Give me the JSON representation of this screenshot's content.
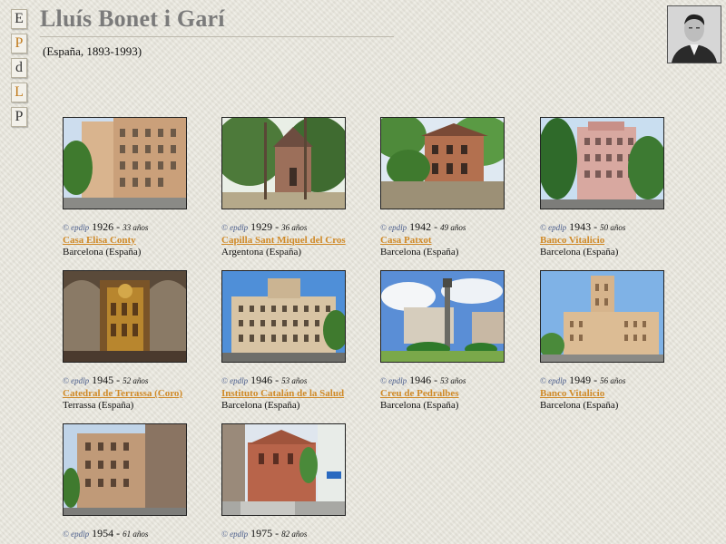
{
  "nav": {
    "letters": [
      "E",
      "P",
      "d",
      "L",
      "P"
    ]
  },
  "header": {
    "title": "Lluís Bonet i Garí",
    "subtitle": "(España, 1893-1993)"
  },
  "works": [
    {
      "copy": "© epdlp",
      "year": "1926",
      "sep": "-",
      "age": "33 años",
      "name": "Casa Elisa Conty",
      "location": "Barcelona (España)"
    },
    {
      "copy": "© epdlp",
      "year": "1929",
      "sep": "-",
      "age": "36 años",
      "name": "Capilla Sant Miquel del Cros",
      "location": "Argentona (España)"
    },
    {
      "copy": "© epdlp",
      "year": "1942",
      "sep": "-",
      "age": "49 años",
      "name": "Casa Patxot",
      "location": "Barcelona (España)"
    },
    {
      "copy": "© epdlp",
      "year": "1943",
      "sep": "-",
      "age": "50 años",
      "name": "Banco Vitalicio",
      "location": "Barcelona (España)"
    },
    {
      "copy": "© epdlp",
      "year": "1945",
      "sep": "-",
      "age": "52 años",
      "name": "Catedral de Terrassa (Coro)",
      "location": "Terrassa (España)"
    },
    {
      "copy": "© epdlp",
      "year": "1946",
      "sep": "-",
      "age": "53 años",
      "name": "Instituto Catalán de la Salud",
      "location": "Barcelona (España)"
    },
    {
      "copy": "© epdlp",
      "year": "1946",
      "sep": "-",
      "age": "53 años",
      "name": "Creu de Pedralbes",
      "location": "Barcelona (España)"
    },
    {
      "copy": "© epdlp",
      "year": "1949",
      "sep": "-",
      "age": "56 años",
      "name": "Banco Vitalicio",
      "location": "Barcelona (España)"
    },
    {
      "copy": "© epdlp",
      "year": "1954",
      "sep": "-",
      "age": "61 años",
      "name": "",
      "location": ""
    },
    {
      "copy": "© epdlp",
      "year": "1975",
      "sep": "-",
      "age": "82 años",
      "name": "",
      "location": ""
    }
  ],
  "colors": {
    "title": "#7b7b7b",
    "link": "#d08a28",
    "copyright": "#4a5d8c",
    "background": "#e8e6dc"
  }
}
